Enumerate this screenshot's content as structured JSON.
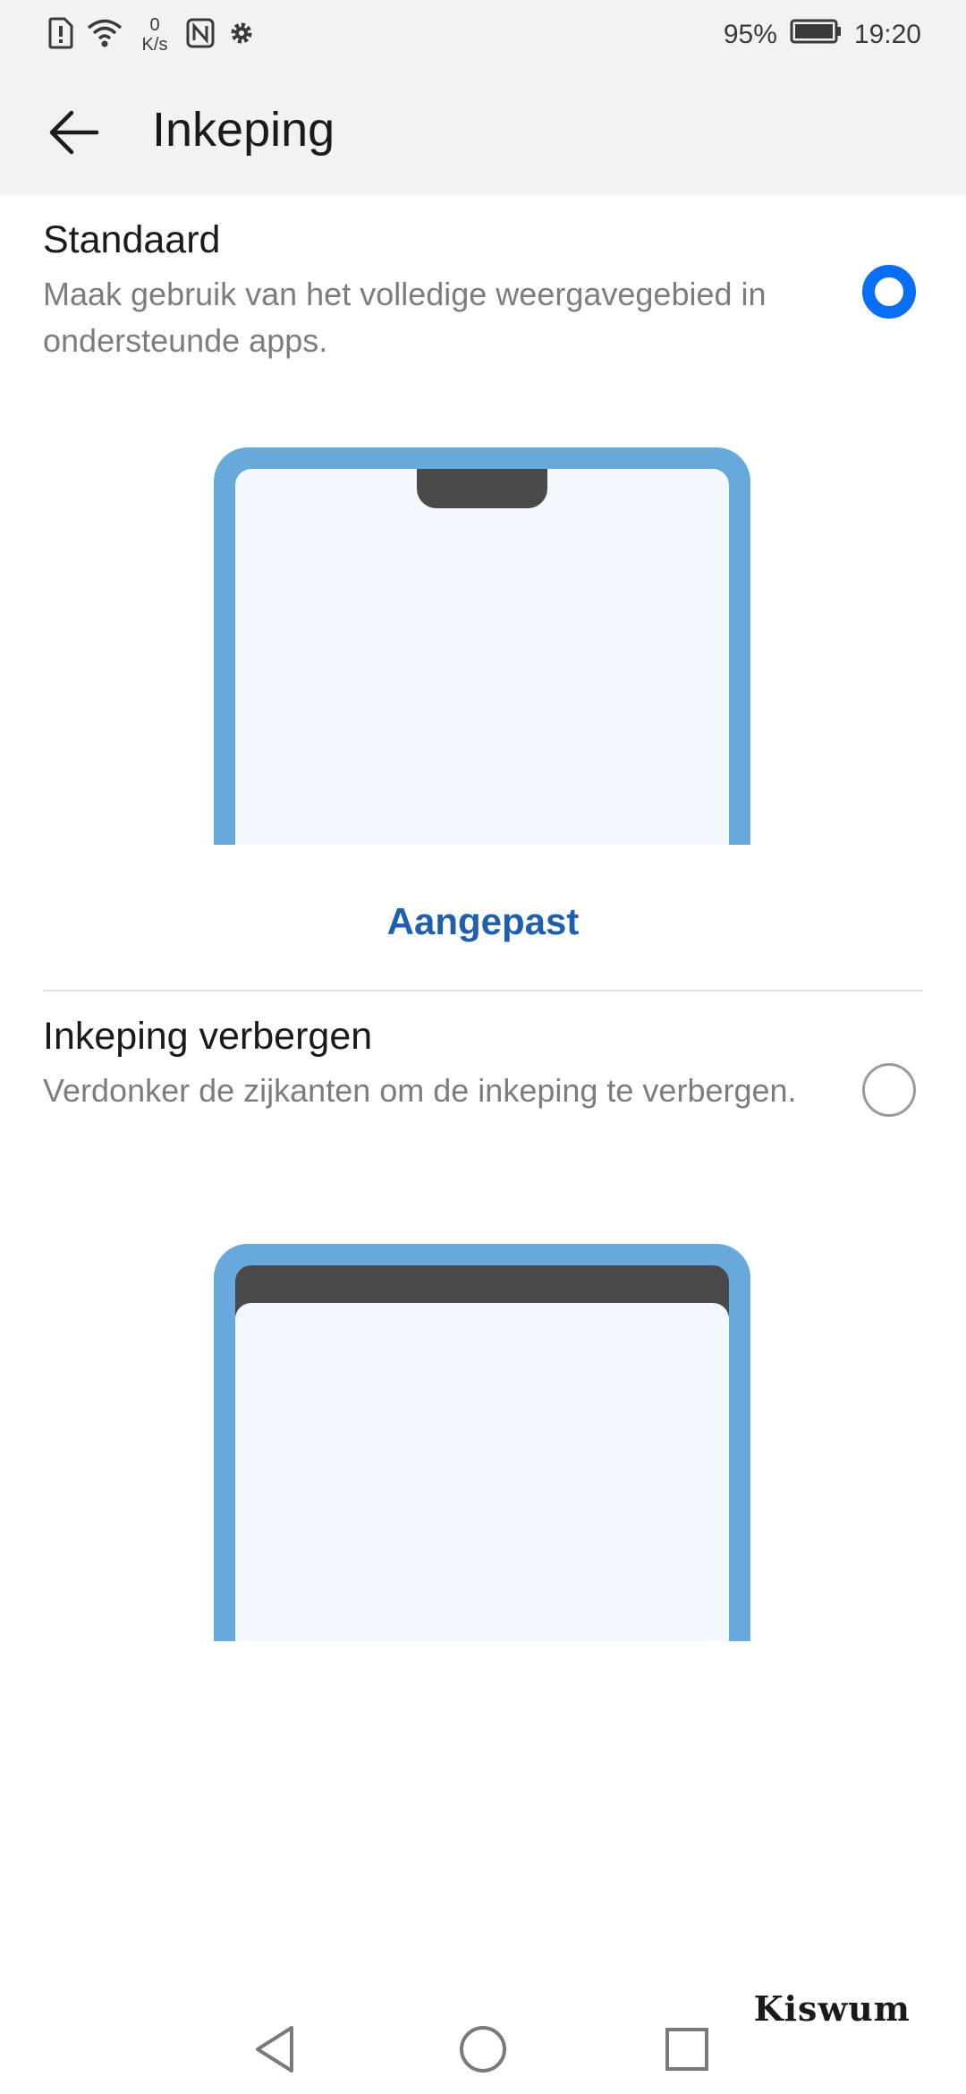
{
  "status_bar": {
    "speed_value": "0",
    "speed_unit": "K/s",
    "battery": "95%",
    "time": "19:20",
    "icons": [
      "alert-sim-icon",
      "wifi-icon",
      "nfc-icon",
      "gear-icon",
      "battery-icon"
    ]
  },
  "header": {
    "title": "Inkeping",
    "back_icon": "arrow-left-icon"
  },
  "options": [
    {
      "title": "Standaard",
      "description": "Maak gebruik van het volledige weergavegebied in ondersteunde apps.",
      "selected": true
    },
    {
      "title": "Inkeping verbergen",
      "description": "Verdonker de zijkanten om de inkeping te verbergen.",
      "selected": false
    }
  ],
  "customize_label": "Aangepast",
  "watermark": "Kiswum",
  "colors": {
    "accent": "#0a6ef5",
    "link": "#1f5fad",
    "phone_frame": "#68a9dc",
    "phone_screen": "#f2f8fe",
    "notch": "#4a4a4a"
  },
  "nav": [
    "back-triangle-icon",
    "home-circle-icon",
    "recents-square-icon"
  ]
}
